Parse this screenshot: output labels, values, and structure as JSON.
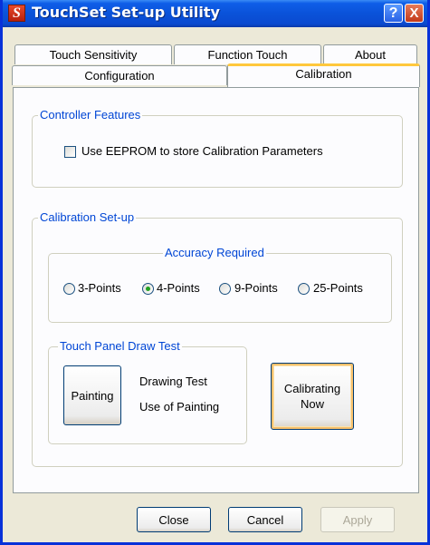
{
  "window": {
    "title": "TouchSet Set-up Utility",
    "icon_letter": "S"
  },
  "titlebar_buttons": {
    "help": "?",
    "close": "X"
  },
  "tabs": {
    "back_row": [
      "Touch Sensitivity",
      "Function Touch",
      "About"
    ],
    "front_row": [
      "Configuration",
      "Calibration"
    ],
    "selected": "Calibration"
  },
  "controller_features": {
    "legend": "Controller Features",
    "eeprom_label": "Use EEPROM to store Calibration Parameters",
    "eeprom_checked": false
  },
  "calibration_setup": {
    "legend": "Calibration Set-up",
    "accuracy": {
      "legend": "Accuracy Required",
      "options": [
        "3-Points",
        "4-Points",
        "9-Points",
        "25-Points"
      ],
      "selected": "4-Points"
    },
    "draw_test": {
      "legend": "Touch Panel Draw Test",
      "painting_button": "Painting",
      "line1": "Drawing Test",
      "line2": "Use of Painting"
    },
    "calibrate_button_line1": "Calibrating",
    "calibrate_button_line2": "Now"
  },
  "footer": {
    "close": "Close",
    "cancel": "Cancel",
    "apply": "Apply"
  },
  "colors": {
    "titlebar": "#0a52d9",
    "group_legend": "#0046d5",
    "focus": "#f7c06b",
    "tab_highlight": "#ffc83c"
  }
}
